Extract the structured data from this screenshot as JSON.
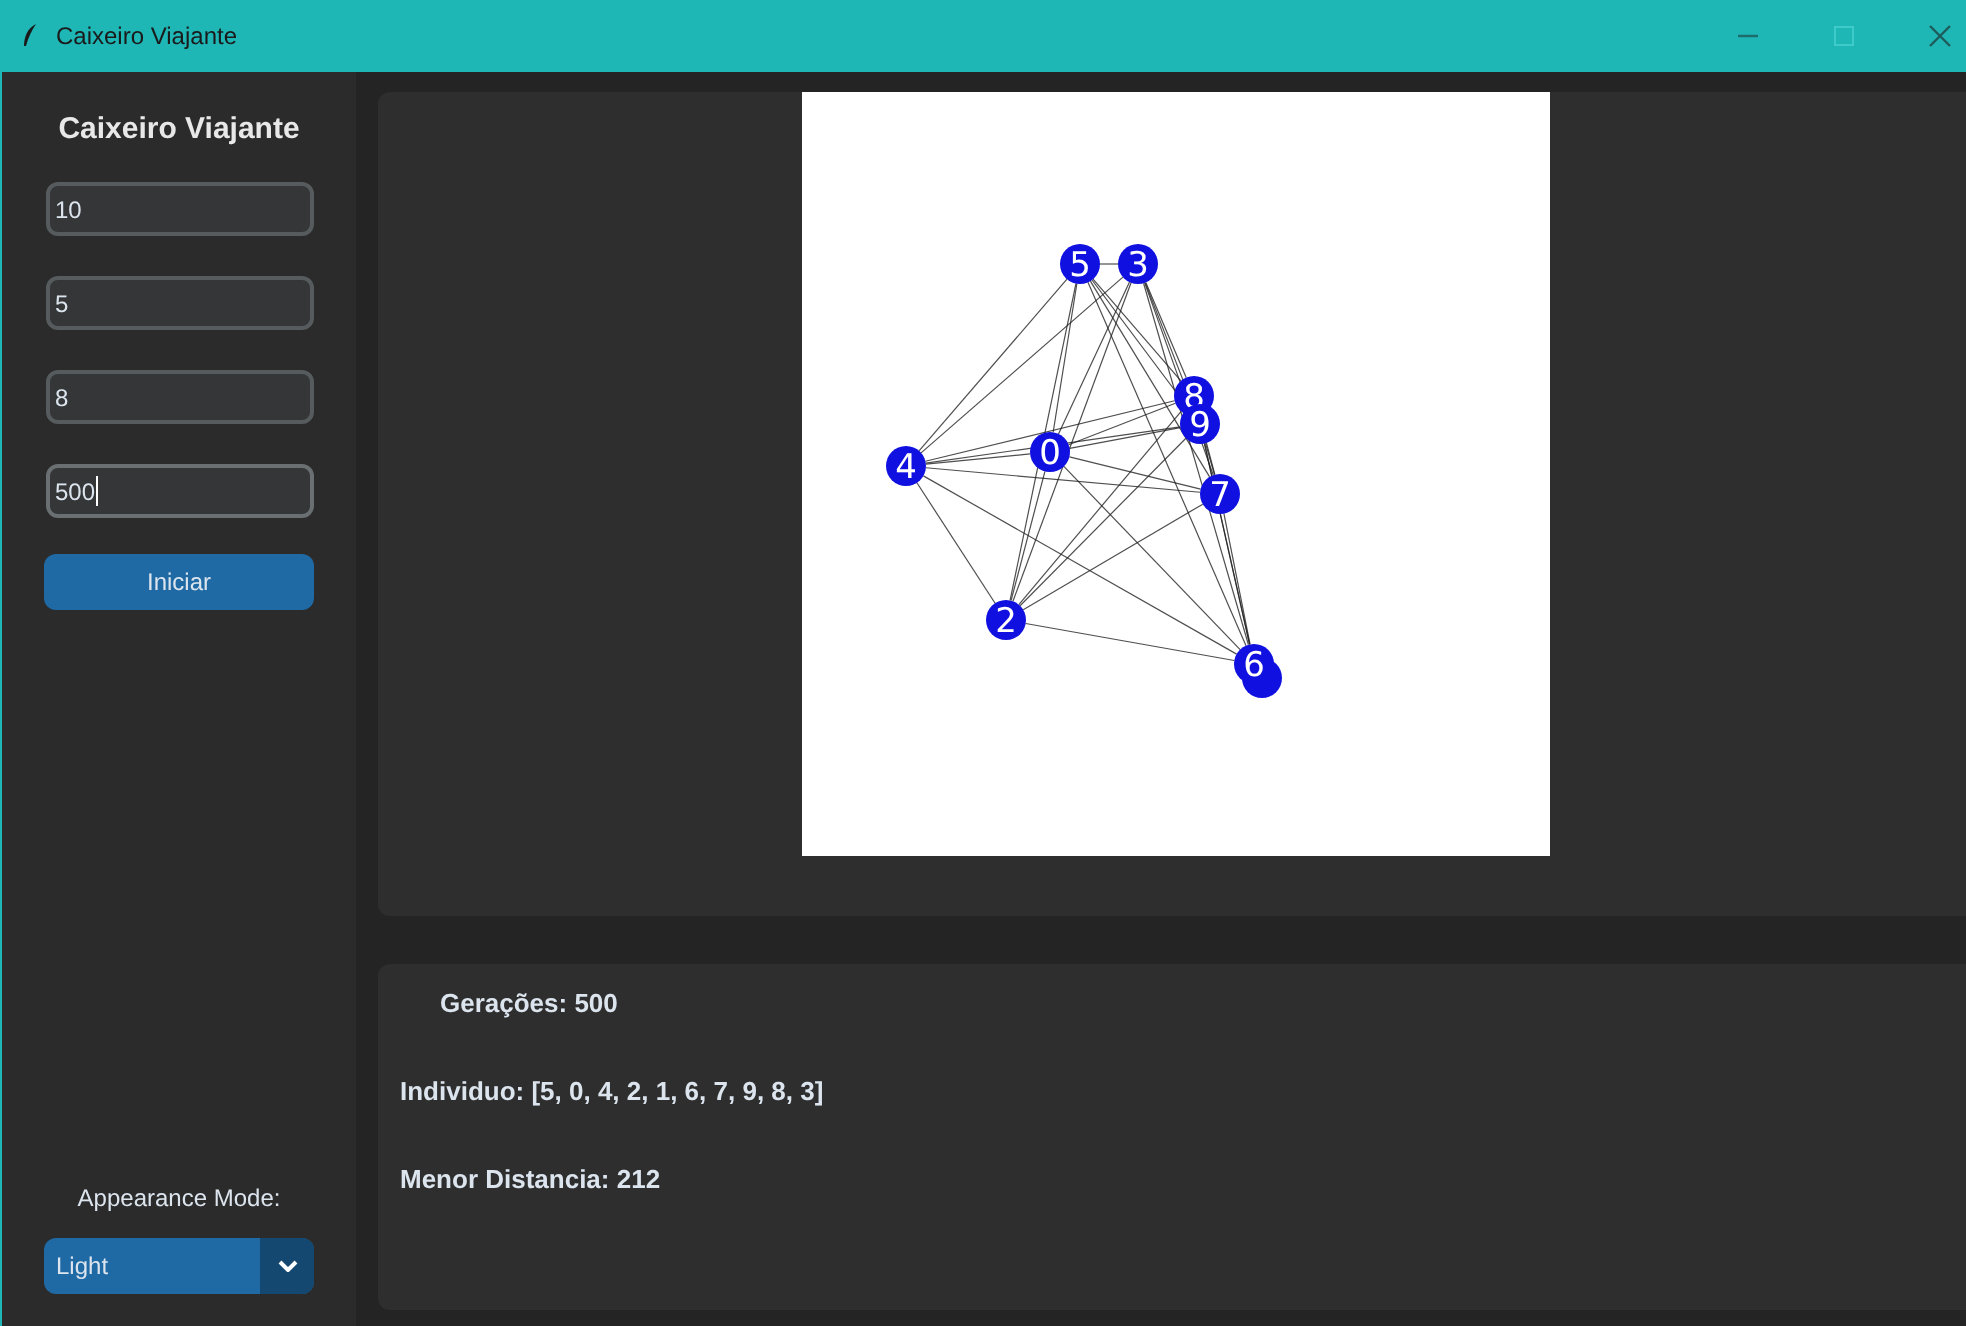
{
  "window": {
    "title": "Caixeiro Viajante"
  },
  "sidebar": {
    "title": "Caixeiro Viajante",
    "fields": [
      {
        "value": "10",
        "focused": false
      },
      {
        "value": "5",
        "focused": false
      },
      {
        "value": "8",
        "focused": false
      },
      {
        "value": "500",
        "focused": true
      }
    ],
    "start_button": "Iniciar",
    "appearance_label": "Appearance Mode:",
    "appearance_mode": "Light"
  },
  "graph": {
    "nodes": [
      {
        "label": "0"
      },
      {
        "label": "2"
      },
      {
        "label": "3"
      },
      {
        "label": "4"
      },
      {
        "label": "5"
      },
      {
        "label": "6"
      },
      {
        "label": "7"
      },
      {
        "label": "8"
      },
      {
        "label": "9"
      }
    ]
  },
  "results": {
    "generations": "Gerações: 500",
    "individual": "Individuo: [5, 0, 4, 2, 1, 6, 7, 9, 8, 3]",
    "distance": "Menor Distancia: 212"
  }
}
